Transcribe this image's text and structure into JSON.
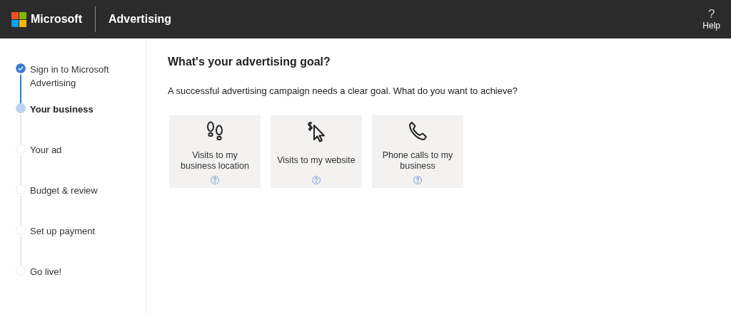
{
  "header": {
    "brand": "Microsoft",
    "product": "Advertising",
    "help": {
      "glyph": "?",
      "label": "Help"
    }
  },
  "steps": [
    {
      "label": "Sign in to Microsoft Advertising",
      "kind": "done",
      "selected": false
    },
    {
      "label": "Your business",
      "kind": "current",
      "selected": true
    },
    {
      "label": "Your ad",
      "kind": "todo",
      "selected": false
    },
    {
      "label": "Budget & review",
      "kind": "todo",
      "selected": false
    },
    {
      "label": "Set up payment",
      "kind": "todo",
      "selected": false
    },
    {
      "label": "Go live!",
      "kind": "todo",
      "selected": false
    }
  ],
  "main": {
    "title": "What's your advertising goal?",
    "description": "A successful advertising campaign needs a clear goal. What do you want to achieve?",
    "goals": [
      {
        "label": "Visits to my business location",
        "kind": "footprints"
      },
      {
        "label": "Visits to my website",
        "kind": "dollar-cursor"
      },
      {
        "label": "Phone calls to my business",
        "kind": "phone"
      }
    ]
  }
}
